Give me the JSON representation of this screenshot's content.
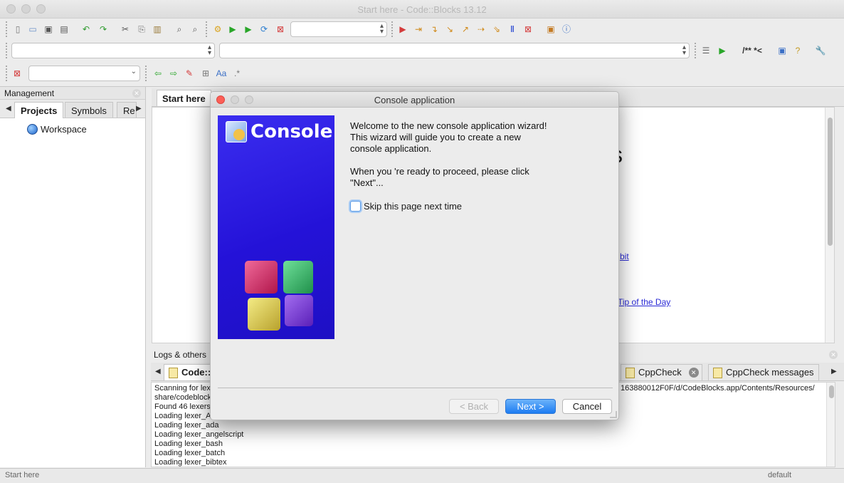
{
  "window": {
    "title": "Start here - Code::Blocks 13.12"
  },
  "toolbars": {
    "icons_row1": [
      "new-file-icon",
      "open-icon",
      "save-icon",
      "save-all-icon",
      "undo-icon",
      "redo-icon",
      "cut-icon",
      "copy-icon",
      "paste-icon",
      "find-icon",
      "replace-icon",
      "build-icon",
      "run-icon",
      "build-run-icon",
      "rebuild-icon",
      "abort-icon"
    ],
    "debug_icons": [
      "debug-icon",
      "run-to-cursor-icon",
      "next-line-icon",
      "step-into-icon",
      "step-out-icon",
      "next-instruction-icon",
      "step-into-instruction-icon",
      "break-icon",
      "stop-debug-icon",
      "debug-windows-icon",
      "info-icon"
    ],
    "doxy_label": "/** *<"
  },
  "management": {
    "title": "Management",
    "tabs": [
      "Projects",
      "Symbols",
      "Re"
    ],
    "workspace": "Workspace"
  },
  "editor": {
    "tab": "Start here",
    "partial_heading": "s",
    "links": [
      "bit",
      "Tip of the Day"
    ]
  },
  "logs": {
    "title": "Logs & others",
    "tabs": [
      "Code::",
      "CppCheck",
      "CppCheck messages"
    ],
    "path_text": "163880012F0F/d/CodeBlocks.app/Contents/Resources/",
    "lines": [
      "Scanning for lexe",
      "share/codeblock",
      "Found 46 lexers",
      "Loading lexer_A",
      "Loading lexer_ada",
      "Loading lexer_angelscript",
      "Loading lexer_bash",
      "Loading lexer_batch",
      "Loading lexer_bibtex"
    ]
  },
  "status": {
    "left": "Start here",
    "right": "default"
  },
  "dialog": {
    "title": "Console application",
    "banner_title": "Console",
    "welcome": "Welcome to the new console application wizard!",
    "guide_line1": "This wizard will guide you to create a new",
    "guide_line2": "console application.",
    "proceed_line1": "When you 're ready to proceed, please click",
    "proceed_line2": "\"Next\"...",
    "skip_label": "Skip this page next time",
    "skip_checked": false,
    "back": "< Back",
    "next": "Next >",
    "cancel": "Cancel"
  },
  "colors": {
    "banner": "#2a18dc",
    "accent": "#1d7cf2",
    "link": "#2a2ad6"
  }
}
